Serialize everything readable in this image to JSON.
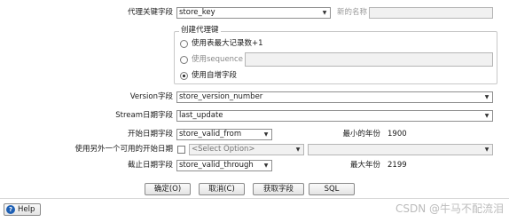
{
  "form": {
    "lookup_field_label": "代理关键字段",
    "lookup_field_value": "store_key",
    "new_name_label": "新的名称",
    "new_name_value": "",
    "group_title": "创建代理键",
    "opt_table_max_label": "使用表最大记录数+1",
    "opt_sequence_label": "使用sequence",
    "opt_sequence_value": "",
    "opt_autoinc_label": "使用自增字段",
    "version_label": "Version字段",
    "version_value": "store_version_number",
    "stream_date_label": "Stream日期字段",
    "stream_date_value": "last_update",
    "start_date_label": "开始日期字段",
    "start_date_value": "store_valid_from",
    "min_year_label": "最小的年份",
    "min_year_value": "1900",
    "alt_start_label": "使用另外一个可用的开始日期",
    "alt_start_select": "<Select Option>",
    "alt_start_field": "",
    "end_date_label": "截止日期字段",
    "end_date_value": "store_valid_through",
    "max_year_label": "最大年份",
    "max_year_value": "2199"
  },
  "buttons": {
    "ok": "确定(O)",
    "cancel": "取消(C)",
    "get_fields": "获取字段",
    "sql": "SQL",
    "help": "Help"
  },
  "icons": {
    "dropdown": "▼",
    "help": "?"
  },
  "watermark": "CSDN @牛马不配流泪"
}
